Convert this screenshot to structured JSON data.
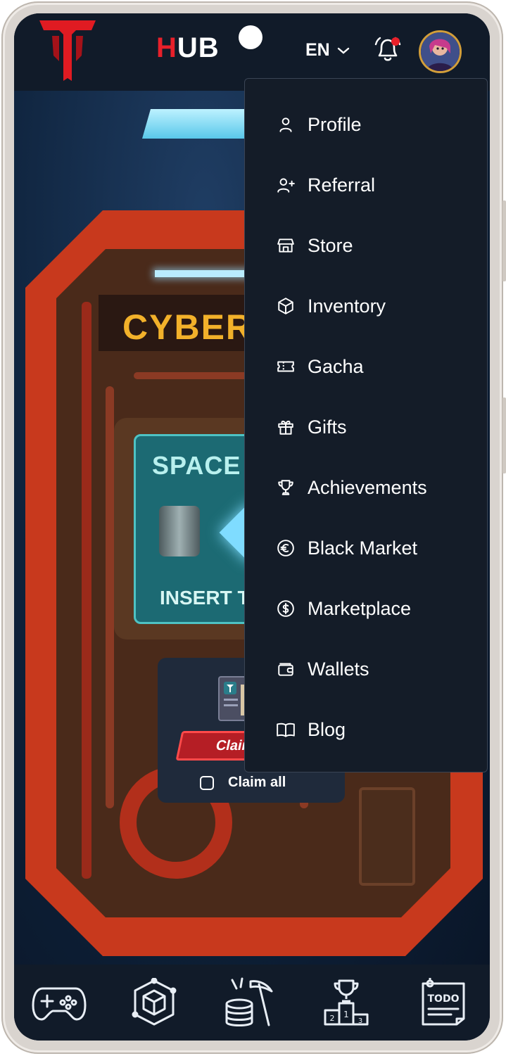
{
  "header": {
    "hub_logo": {
      "first": "H",
      "rest": "UB"
    },
    "language": "EN",
    "notification_dot_color": "#e8202a"
  },
  "hero": {
    "door_title": "CYBER",
    "screen_title": "SPACE F",
    "screen_footer": "INSERT T"
  },
  "reward": {
    "claim_label": "Clain",
    "claim_all_label": "Claim all"
  },
  "menu": {
    "items": [
      {
        "label": "Profile",
        "icon": "user-icon"
      },
      {
        "label": "Referral",
        "icon": "user-plus-icon"
      },
      {
        "label": "Store",
        "icon": "store-icon"
      },
      {
        "label": "Inventory",
        "icon": "box-icon"
      },
      {
        "label": "Gacha",
        "icon": "ticket-icon"
      },
      {
        "label": "Gifts",
        "icon": "gift-icon"
      },
      {
        "label": "Achievements",
        "icon": "trophy-icon"
      },
      {
        "label": "Black Market",
        "icon": "euro-icon"
      },
      {
        "label": "Marketplace",
        "icon": "dollar-icon"
      },
      {
        "label": "Wallets",
        "icon": "wallet-icon"
      },
      {
        "label": "Blog",
        "icon": "book-open-icon"
      }
    ]
  },
  "bottom_nav": {
    "items": [
      {
        "icon": "gamepad-icon"
      },
      {
        "icon": "cube-icon"
      },
      {
        "icon": "mining-icon"
      },
      {
        "icon": "podium-icon"
      },
      {
        "icon": "todo-icon",
        "text": "TODO"
      }
    ]
  },
  "colors": {
    "accent_red": "#e8202a",
    "menu_bg": "#141c28",
    "header_bg": "#111b29",
    "avatar_ring": "#d29e3a"
  }
}
